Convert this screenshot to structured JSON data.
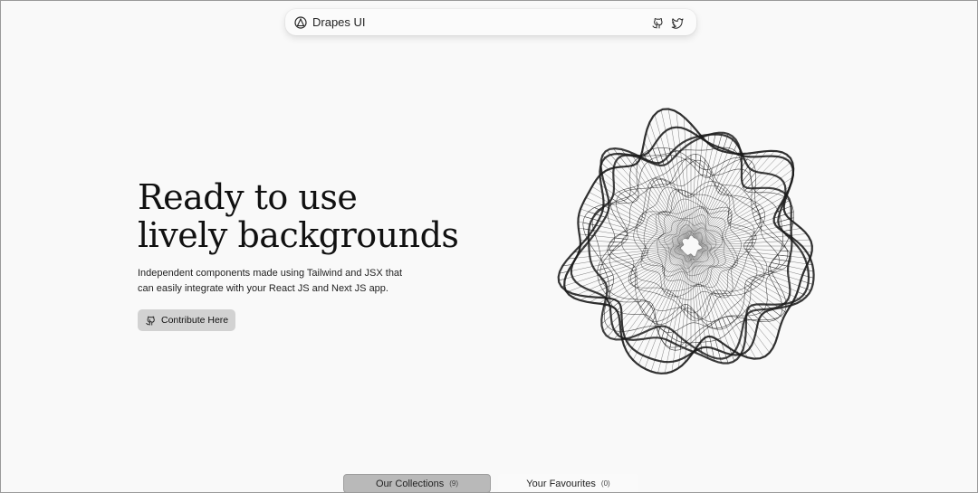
{
  "navbar": {
    "brand_name": "Drapes UI",
    "brand_icon": "drapes-logo-icon",
    "links": [
      {
        "icon": "github-icon"
      },
      {
        "icon": "twitter-icon"
      }
    ]
  },
  "hero": {
    "title_line1": "Ready to use",
    "title_line2": "lively backgrounds",
    "subtitle_line1": "Independent components made using Tailwind and JSX that",
    "subtitle_line2": "can easily integrate with your React JS and Next JS app.",
    "cta_label": "Contribute Here",
    "cta_icon": "github-icon"
  },
  "tabs": [
    {
      "label": "Our Collections",
      "count": "(9)",
      "active": true
    },
    {
      "label": "Your Favourites",
      "count": "(0)",
      "active": false
    }
  ],
  "colors": {
    "background": "#f9f9f9",
    "active_tab": "#b9b9b9",
    "cta_bg": "#d2d2d2",
    "mesh": "#1a1a1a"
  }
}
